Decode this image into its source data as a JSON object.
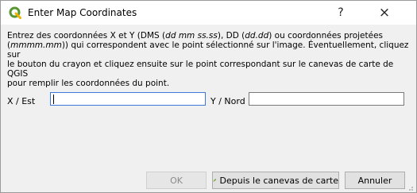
{
  "window": {
    "title": "Enter Map Coordinates",
    "help_label": "?",
    "close_label": "×",
    "brand_color": "#589632",
    "app_icon": "qgis-icon"
  },
  "description": {
    "p1": "Entrez des coordonnées X et Y (DMS (",
    "i1": "dd mm ss.ss",
    "p2": "), DD (",
    "i2": "dd.dd",
    "p3": ") ou coordonnées projetées\n(",
    "i3": "mmmm.mm",
    "p4": ")) qui correspondent avec le point sélectionné sur l'image. Éventuellement, cliquez sur\nle bouton du crayon et cliquez ensuite sur le point correspondant sur le canevas de carte de QGIS\npour remplir les coordonnées du point."
  },
  "fields": {
    "x_label": "X / Est",
    "x_value": "",
    "y_label": "Y / Nord",
    "y_value": ""
  },
  "buttons": {
    "ok": "OK",
    "canvas": "Depuis le canevas de carte",
    "canvas_icon": "pencil-icon",
    "cancel": "Annuler"
  }
}
